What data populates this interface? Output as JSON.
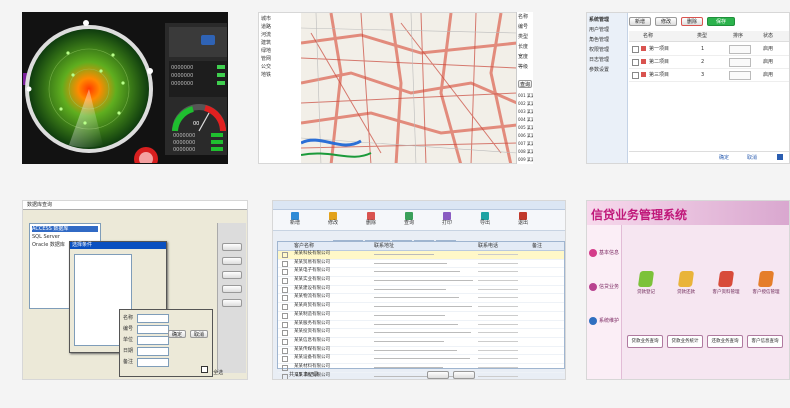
{
  "gallery": {
    "thumb1": {
      "panel_rows": [
        {
          "label": "0000000",
          "value": "100"
        },
        {
          "label": "0000000",
          "value": "100"
        },
        {
          "label": "0000000",
          "value": "100"
        }
      ],
      "gauge_value": "00",
      "stats_rows": [
        {
          "label": "0000000",
          "value": "0.00"
        },
        {
          "label": "0000000",
          "value": "0.00"
        },
        {
          "label": "0000000",
          "value": "0.00"
        },
        {
          "label": "0000000",
          "value": "0.00"
        }
      ]
    },
    "thumb2": {
      "tree_items": [
        "城市",
        "道路",
        "河流",
        "建筑",
        "绿地",
        "管网",
        "公交",
        "地铁"
      ],
      "field_labels": [
        "名称",
        "编号",
        "类型",
        "长度",
        "宽度",
        "等级"
      ],
      "query_button": "查询",
      "result_rows": [
        "001 某某路",
        "002 某某街",
        "003 某某路",
        "004 某某巷",
        "005 某某路",
        "006 某某街",
        "007 某某路",
        "008 某某大道",
        "009 某某路"
      ]
    },
    "thumb3": {
      "tree_items": [
        "系统管理",
        "用户管理",
        "角色管理",
        "权限管理",
        "日志管理",
        "参数设置"
      ],
      "tabs": [
        "新增",
        "修改",
        "删除",
        "保存"
      ],
      "columns": [
        "名称",
        "类型",
        "排序",
        "状态"
      ],
      "rows": [
        {
          "name": "第一项目",
          "type": "1",
          "state": "启用"
        },
        {
          "name": "第二项目",
          "type": "2",
          "state": "启用"
        },
        {
          "name": "第三项目",
          "type": "3",
          "state": "启用"
        }
      ],
      "footer_labels": [
        "确定",
        "取消"
      ]
    },
    "thumb4": {
      "window_title": "数据库查询",
      "dialog_title": "选择条件",
      "list_rows": [
        "ACCESS 数据库",
        "SQL Server",
        "Oracle 数据库"
      ],
      "form_labels": [
        "名称",
        "编号",
        "单位",
        "日期",
        "备注"
      ],
      "ok_button": "确定",
      "cancel_button": "取消",
      "checkbox_label": "全选"
    },
    "thumb5": {
      "menu": [
        "文件(F)",
        "编辑(E)",
        "查看(V)"
      ],
      "toolbar": [
        "新增",
        "修改",
        "删除",
        "查询",
        "打印",
        "导出",
        "退出"
      ],
      "tabs": [
        "客户信息",
        "联系人",
        "合同",
        "收款",
        "报表"
      ],
      "columns": [
        "客户名称",
        "联系地址",
        "联系电话",
        "备注"
      ],
      "rows": [
        "某某科技有限公司",
        "某某贸易有限公司",
        "某某电子有限公司",
        "某某实业有限公司",
        "某某建设有限公司",
        "某某物流有限公司",
        "某某商贸有限公司",
        "某某制造有限公司",
        "某某服务有限公司",
        "某某投资有限公司",
        "某某信息有限公司",
        "某某传媒有限公司",
        "某某设备有限公司",
        "某某材料有限公司",
        "某某工程有限公司"
      ],
      "status": "共 15 条记录"
    },
    "thumb6": {
      "title": "信贷业务管理系统",
      "side_items": [
        "基本信息",
        "信贷业务",
        "系统维护"
      ],
      "icon_labels": [
        "贷款登记",
        "贷款还款",
        "客户资料管理",
        "客户授信管理"
      ],
      "buttons": [
        "贷款业务查询",
        "贷款业务统计",
        "还款业务查询",
        "客户信息查询"
      ]
    }
  }
}
